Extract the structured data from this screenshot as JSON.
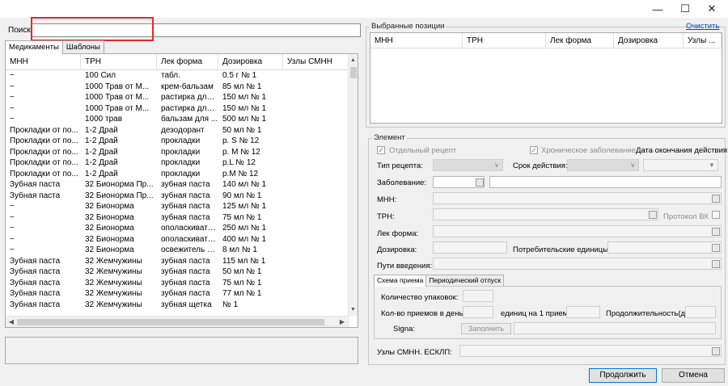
{
  "window": {
    "top_cut_text": "~~~~ ~~~~~~~  ~~~ ~~~~~",
    "minimize_icon": "minimize-icon",
    "maximize_icon": "maximize-icon",
    "close_icon": "close-icon"
  },
  "search": {
    "label": "Поиск:",
    "value": ""
  },
  "left_tabs": [
    "Медикаменты",
    "Шаблоны"
  ],
  "grid": {
    "columns": [
      "МНН",
      "ТРН",
      "Лек форма",
      "Дозировка",
      "Узлы СМНН"
    ],
    "rows": [
      [
        "~",
        "100 Сил",
        "табл.",
        "0.5 г № 1",
        ""
      ],
      [
        "~",
        "1000 Трав от М...",
        "крем-бальзам",
        "85 мл № 1",
        ""
      ],
      [
        "~",
        "1000 Трав от М...",
        "растирка для ...",
        "150 мл № 1",
        ""
      ],
      [
        "~",
        "1000 Трав от М...",
        "растирка для ...",
        "150 мл № 1",
        ""
      ],
      [
        "~",
        "1000 трав",
        "бальзам для ...",
        "500 мл № 1",
        ""
      ],
      [
        "Прокладки от по...",
        "1-2 Драй",
        "дезодорант",
        "50 мл № 1",
        ""
      ],
      [
        "Прокладки от по...",
        "1-2 Драй",
        "прокладки",
        "р. S № 12",
        ""
      ],
      [
        "Прокладки от по...",
        "1-2 Драй",
        "прокладки",
        "р. M № 12",
        ""
      ],
      [
        "Прокладки от по...",
        "1-2 Драй",
        "прокладки",
        "р.L № 12",
        ""
      ],
      [
        "Прокладки от по...",
        "1-2 Драй",
        "прокладки",
        "р.M № 12",
        ""
      ],
      [
        "Зубная паста",
        "32 Бионорма Пр...",
        "зубная паста",
        "140 мл № 1",
        ""
      ],
      [
        "Зубная паста",
        "32 Бионорма Пр...",
        "зубная паста",
        "90 мл № 1",
        ""
      ],
      [
        "~",
        "32 Бионорма",
        "зубная паста",
        "125 мл № 1",
        ""
      ],
      [
        "~",
        "32 Бионорма",
        "зубная паста",
        "75 мл № 1",
        ""
      ],
      [
        "~",
        "32 Бионорма",
        "ополаскивате...",
        "250 мл № 1",
        ""
      ],
      [
        "~",
        "32 Бионорма",
        "ополаскивате...",
        "400 мл № 1",
        ""
      ],
      [
        "~",
        "32 Бионорма",
        "освежитель д...",
        "8 мл № 1",
        ""
      ],
      [
        "Зубная паста",
        "32 Жемчужины",
        "зубная паста",
        "115 мл № 1",
        ""
      ],
      [
        "Зубная паста",
        "32 Жемчужины",
        "зубная паста",
        "50 мл № 1",
        ""
      ],
      [
        "Зубная паста",
        "32 Жемчужины",
        "зубная паста",
        "75 мл № 1",
        ""
      ],
      [
        "Зубная паста",
        "32 Жемчужины",
        "зубная паста",
        "77 мл № 1",
        ""
      ],
      [
        "Зубная паста",
        "32 Жемчужины",
        "зубная щетка",
        " № 1",
        ""
      ]
    ]
  },
  "selected": {
    "title": "Выбранные позиции",
    "clear_link": "Очистить",
    "columns": [
      "МНН",
      "ТРН",
      "Лек форма",
      "Дозировка",
      "Узлы ..."
    ]
  },
  "element": {
    "title": "Элемент",
    "separate_recipe": "Отдельный рецепт",
    "chronic": "Хроническое заболевание",
    "end_date": "Дата окончания действия:",
    "recipe_type": "Тип рецепта:",
    "validity": "Срок действия:",
    "disease": "Заболевание:",
    "mnn": "МНН:",
    "trn": "ТРН:",
    "protocol_vk": "Протокол ВК",
    "lek_forma": "Лек форма:",
    "dosage": "Дозировка:",
    "consumer_units": "Потребительские единицы:",
    "routes": "Пути введения:",
    "nodes": "Узлы СМНН. ЕСКЛП:"
  },
  "schema_tabs": [
    "Схема приема",
    "Периодический отпуск"
  ],
  "schema": {
    "packages": "Количество упаковок:",
    "intakes_per_day": "Кол-во приемов в день:",
    "units_per_intake": "единиц на 1 прием:",
    "duration": "Продолжительность(д):",
    "signa": "Signa:",
    "fill_button": "Заполнить"
  },
  "buttons": {
    "continue": "Продолжить",
    "cancel": "Отмена"
  }
}
